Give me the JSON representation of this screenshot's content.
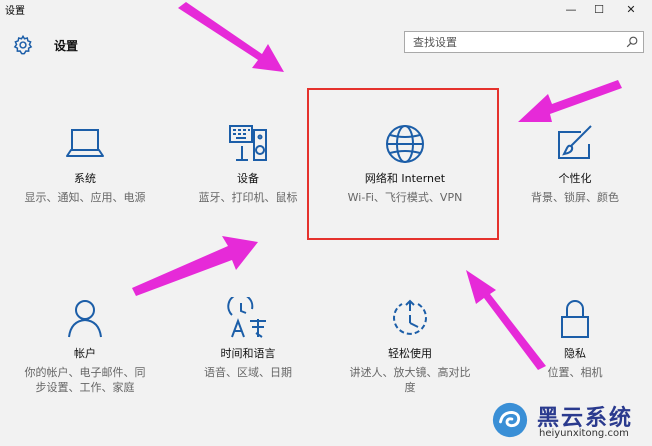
{
  "window": {
    "title": "设置",
    "minimize_glyph": "—",
    "maximize_glyph": "☐",
    "close_glyph": "✕"
  },
  "header": {
    "title": "设置",
    "icon": "gear-icon"
  },
  "search": {
    "placeholder": "查找设置",
    "icon": "search-icon"
  },
  "tiles": [
    {
      "name": "系统",
      "desc": "显示、通知、应用、电源",
      "icon": "laptop-icon"
    },
    {
      "name": "设备",
      "desc": "蓝牙、打印机、鼠标",
      "icon": "keyboard-speaker-icon"
    },
    {
      "name": "网络和 Internet",
      "desc": "Wi-Fi、飞行模式、VPN",
      "icon": "globe-icon"
    },
    {
      "name": "个性化",
      "desc": "背景、锁屏、颜色",
      "icon": "paint-brush-icon"
    },
    {
      "name": "帐户",
      "desc": "你的帐户、电子邮件、同步设置、工作、家庭",
      "icon": "person-icon"
    },
    {
      "name": "时间和语言",
      "desc": "语音、区域、日期",
      "icon": "time-language-icon"
    },
    {
      "name": "轻松使用",
      "desc": "讲述人、放大镜、高对比度",
      "icon": "ease-of-access-icon"
    },
    {
      "name": "隐私",
      "desc": "位置、相机",
      "icon": "lock-icon"
    }
  ],
  "colors": {
    "accent": "#1c5ea8",
    "highlight": "#e5322d",
    "arrow": "#e62ad8"
  },
  "watermark": {
    "name": "黑云系统",
    "url": "heiyunxitong.com"
  }
}
